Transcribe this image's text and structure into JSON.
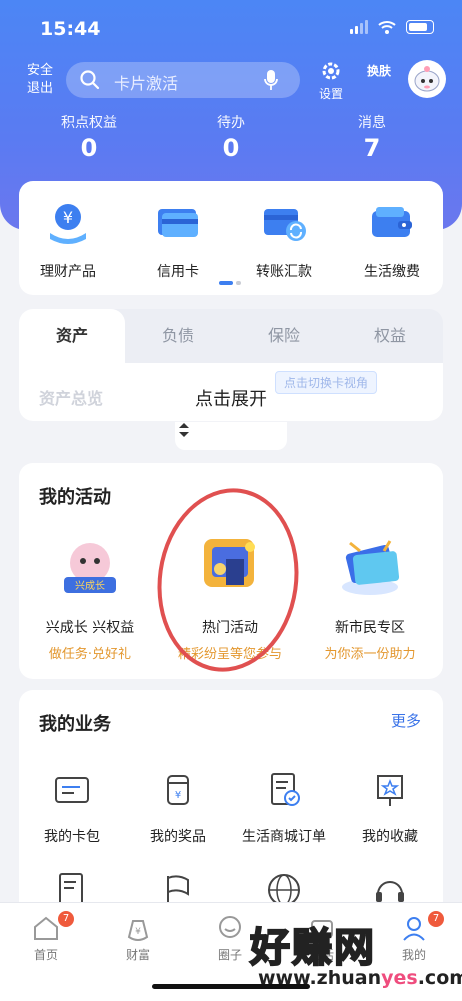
{
  "status": {
    "time": "15:44"
  },
  "topbar": {
    "logout": "安全退出",
    "search_placeholder": "卡片激活",
    "settings": "设置",
    "skin": "换肤"
  },
  "stats": [
    {
      "label": "积点权益",
      "value": "0"
    },
    {
      "label": "待办",
      "value": "0"
    },
    {
      "label": "消息",
      "value": "7"
    }
  ],
  "quick": [
    {
      "label": "理财产品",
      "icon": "wealth-icon"
    },
    {
      "label": "信用卡",
      "icon": "credit-card-icon"
    },
    {
      "label": "转账汇款",
      "icon": "transfer-icon"
    },
    {
      "label": "生活缴费",
      "icon": "wallet-icon"
    }
  ],
  "asset_tabs": [
    "资产",
    "负债",
    "保险",
    "权益"
  ],
  "asset_panel": {
    "overview": "资产总览",
    "switch_hint": "点击切换卡视角",
    "expand": "点击展开"
  },
  "activities": {
    "title": "我的活动",
    "items": [
      {
        "name": "兴成长 兴权益",
        "sub": "做任务·兑好礼"
      },
      {
        "name": "热门活动",
        "sub": "精彩纷呈等您参与"
      },
      {
        "name": "新市民专区",
        "sub": "为你添一份助力"
      }
    ]
  },
  "business": {
    "title": "我的业务",
    "more": "更多",
    "items": [
      "我的卡包",
      "我的奖品",
      "生活商城订单",
      "我的收藏"
    ]
  },
  "tabbar": {
    "items": [
      "首页",
      "财富",
      "圈子",
      "生活",
      "我的"
    ],
    "home_badge": "7",
    "mine_badge": "7"
  },
  "watermark": {
    "main": "好赚网",
    "sub_a": "www.zhuan",
    "sub_b": "yes",
    "sub_c": ".com"
  },
  "colors": {
    "primary": "#4c86f5",
    "accent_orange": "#e3972e",
    "link_blue": "#3a73e8",
    "ring_red": "#e05050"
  }
}
